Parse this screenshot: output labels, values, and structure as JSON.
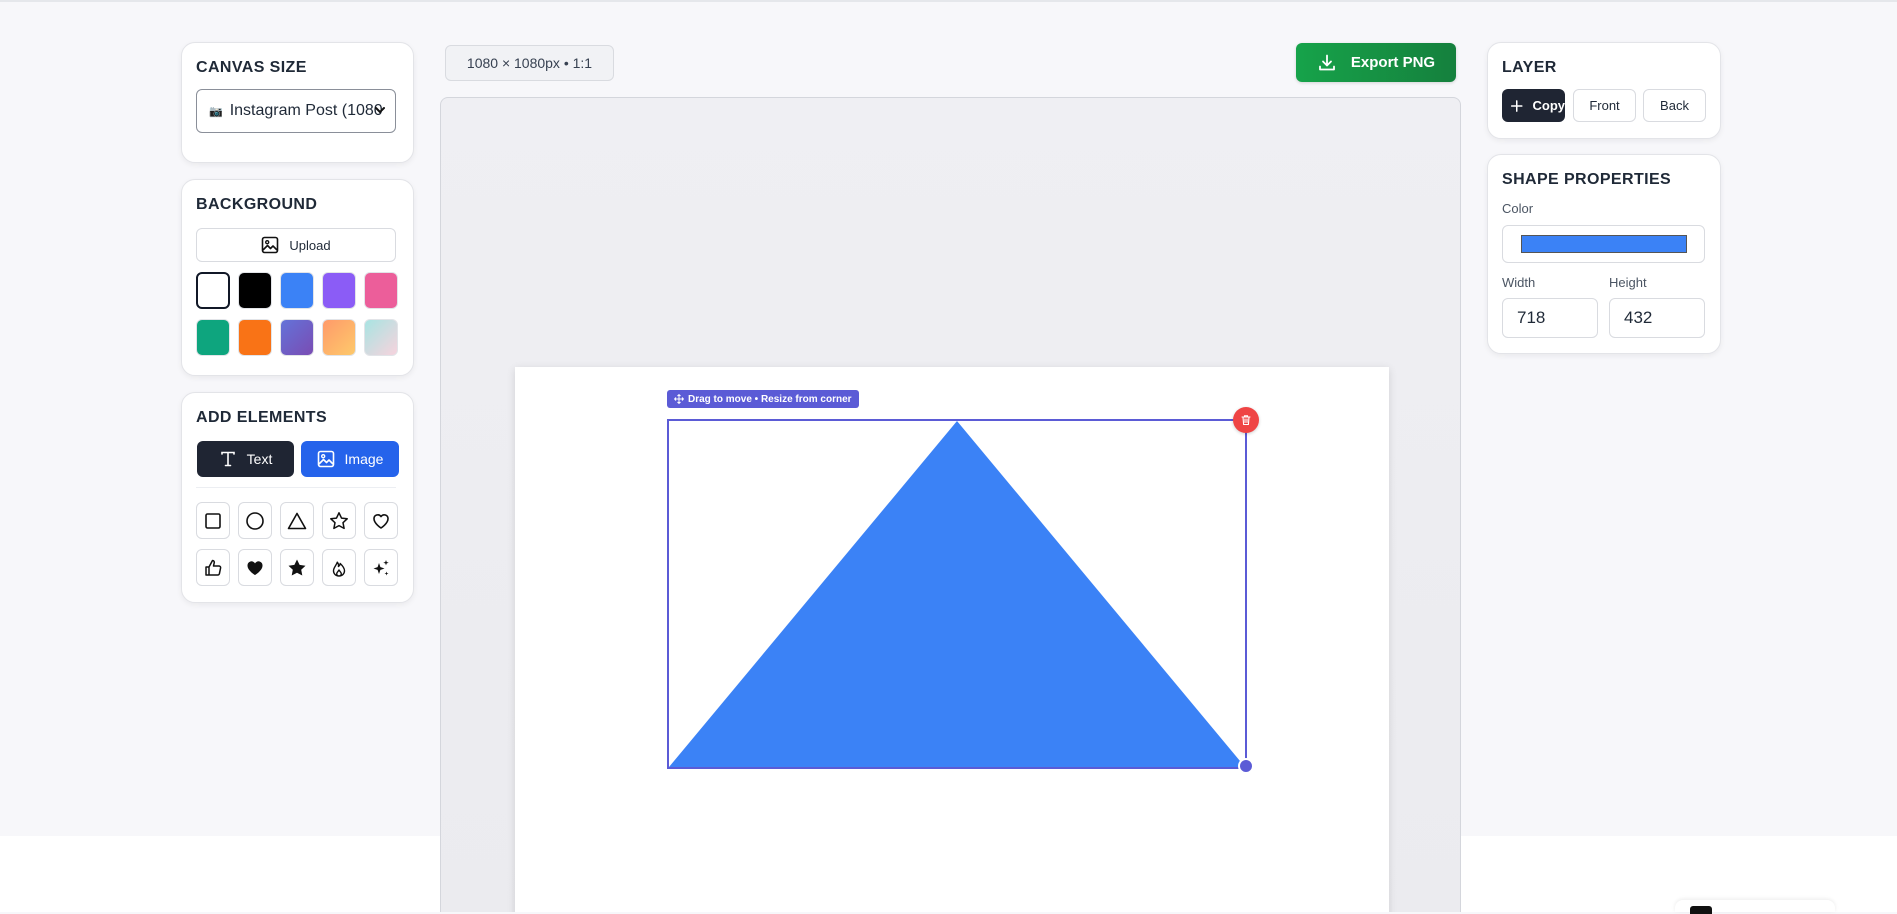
{
  "left": {
    "canvas_size": {
      "title": "CANVAS SIZE",
      "selected_icon": "camera-icon",
      "selected": "Instagram Post (1080"
    },
    "background": {
      "title": "BACKGROUND",
      "upload_label": "Upload",
      "swatches": [
        {
          "name": "white",
          "fill": "#ffffff",
          "selected": true
        },
        {
          "name": "black",
          "fill": "#000000"
        },
        {
          "name": "blue",
          "fill": "#3b82f6"
        },
        {
          "name": "purple",
          "fill": "#8b5cf6"
        },
        {
          "name": "pink",
          "fill": "#ec5e9a"
        },
        {
          "name": "green",
          "fill": "#0ea57e"
        },
        {
          "name": "orange",
          "fill": "#f97316"
        },
        {
          "name": "indigo-gradient",
          "fill": "linear-gradient(135deg,#6373d9,#7a4cb3)"
        },
        {
          "name": "sunset-gradient",
          "fill": "linear-gradient(135deg,#ff9a6a,#fdc96b)"
        },
        {
          "name": "aqua-pink-gradient",
          "fill": "linear-gradient(135deg,#a8e4e2,#f7d3dd)"
        }
      ]
    },
    "add_elements": {
      "title": "ADD ELEMENTS",
      "text_label": "Text",
      "image_label": "Image",
      "shapes": [
        "square-icon",
        "circle-icon",
        "triangle-icon",
        "star-outline-icon",
        "heart-outline-icon",
        "thumbs-up-icon",
        "heart-filled-icon",
        "star-filled-icon",
        "flame-icon",
        "sparkles-icon"
      ]
    }
  },
  "canvas": {
    "dimensions_badge": "1080 × 1080px • 1:1",
    "export_label": "Export PNG",
    "selection_hint": "Drag to move • Resize from corner",
    "shape": {
      "type": "triangle",
      "color": "#3b82f6"
    }
  },
  "right": {
    "layer": {
      "title": "LAYER",
      "copy_label": "Copy",
      "front_label": "Front",
      "back_label": "Back"
    },
    "shape_properties": {
      "title": "SHAPE PROPERTIES",
      "color_label": "Color",
      "color_value": "#3b82f6",
      "width_label": "Width",
      "width_value": "718",
      "height_label": "Height",
      "height_value": "432"
    }
  }
}
